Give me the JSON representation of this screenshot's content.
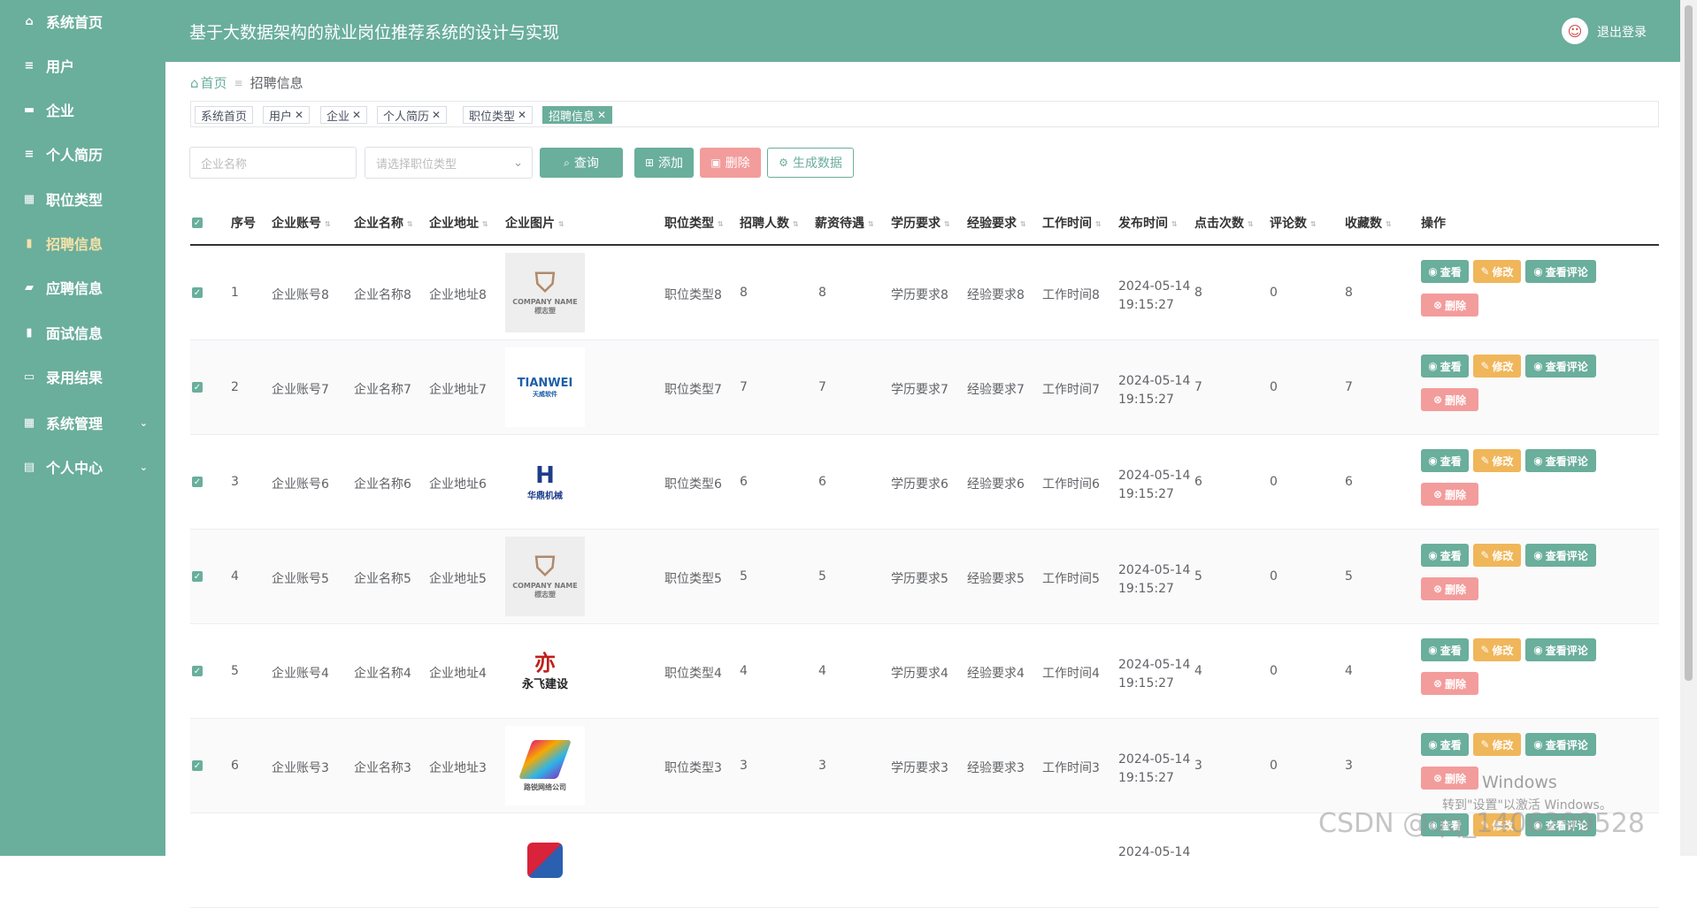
{
  "sidebar": {
    "items": [
      {
        "label": "系统首页",
        "icon": "home-icon"
      },
      {
        "label": "用户",
        "icon": "menu-icon"
      },
      {
        "label": "企业",
        "icon": "briefcase-icon"
      },
      {
        "label": "个人简历",
        "icon": "menu-icon"
      },
      {
        "label": "职位类型",
        "icon": "grid-icon"
      },
      {
        "label": "招聘信息",
        "icon": "clipboard-icon",
        "active": true
      },
      {
        "label": "应聘信息",
        "icon": "chat-icon"
      },
      {
        "label": "面试信息",
        "icon": "clipboard-icon"
      },
      {
        "label": "录用结果",
        "icon": "monitor-icon"
      },
      {
        "label": "系统管理",
        "icon": "grid-icon",
        "expandable": true
      },
      {
        "label": "个人中心",
        "icon": "calendar-icon",
        "expandable": true
      }
    ]
  },
  "header": {
    "title": "基于大数据架构的就业岗位推荐系统的设计与实现",
    "logout": "退出登录"
  },
  "breadcrumb": {
    "home": "首页",
    "current": "招聘信息"
  },
  "tags": [
    {
      "label": "系统首页",
      "closable": false
    },
    {
      "label": "用户",
      "closable": true
    },
    {
      "label": "企业",
      "closable": true
    },
    {
      "label": "个人简历",
      "closable": true
    },
    {
      "label": "职位类型",
      "closable": true
    },
    {
      "label": "招聘信息",
      "closable": true,
      "active": true
    }
  ],
  "filters": {
    "company_name_placeholder": "企业名称",
    "job_type_placeholder": "请选择职位类型",
    "search_label": "查询",
    "add_label": "添加",
    "delete_label": "删除",
    "generate_label": "生成数据"
  },
  "table": {
    "columns": [
      "序号",
      "企业账号",
      "企业名称",
      "企业地址",
      "企业图片",
      "职位类型",
      "招聘人数",
      "薪资待遇",
      "学历要求",
      "经验要求",
      "工作时间",
      "发布时间",
      "点击次数",
      "评论数",
      "收藏数",
      "操作"
    ],
    "rows": [
      {
        "index": "1",
        "account": "企业账号8",
        "name": "企业名称8",
        "address": "企业地址8",
        "logo": "company-name-logo",
        "type": "职位类型8",
        "recruits": "8",
        "salary": "8",
        "education": "学历要求8",
        "experience": "经验要求8",
        "worktime": "工作时间8",
        "date": "2024-05-14",
        "time": "19:15:27",
        "clicks": "8",
        "comments": "0",
        "favorites": "8"
      },
      {
        "index": "2",
        "account": "企业账号7",
        "name": "企业名称7",
        "address": "企业地址7",
        "logo": "tianwei-logo",
        "type": "职位类型7",
        "recruits": "7",
        "salary": "7",
        "education": "学历要求7",
        "experience": "经验要求7",
        "worktime": "工作时间7",
        "date": "2024-05-14",
        "time": "19:15:27",
        "clicks": "7",
        "comments": "0",
        "favorites": "7"
      },
      {
        "index": "3",
        "account": "企业账号6",
        "name": "企业名称6",
        "address": "企业地址6",
        "logo": "huading-logo",
        "type": "职位类型6",
        "recruits": "6",
        "salary": "6",
        "education": "学历要求6",
        "experience": "经验要求6",
        "worktime": "工作时间6",
        "date": "2024-05-14",
        "time": "19:15:27",
        "clicks": "6",
        "comments": "0",
        "favorites": "6"
      },
      {
        "index": "4",
        "account": "企业账号5",
        "name": "企业名称5",
        "address": "企业地址5",
        "logo": "company-name-logo",
        "type": "职位类型5",
        "recruits": "5",
        "salary": "5",
        "education": "学历要求5",
        "experience": "经验要求5",
        "worktime": "工作时间5",
        "date": "2024-05-14",
        "time": "19:15:27",
        "clicks": "5",
        "comments": "0",
        "favorites": "5"
      },
      {
        "index": "5",
        "account": "企业账号4",
        "name": "企业名称4",
        "address": "企业地址4",
        "logo": "yongfei-logo",
        "type": "职位类型4",
        "recruits": "4",
        "salary": "4",
        "education": "学历要求4",
        "experience": "经验要求4",
        "worktime": "工作时间4",
        "date": "2024-05-14",
        "time": "19:15:27",
        "clicks": "4",
        "comments": "0",
        "favorites": "4"
      },
      {
        "index": "6",
        "account": "企业账号3",
        "name": "企业名称3",
        "address": "企业地址3",
        "logo": "colorful-logo",
        "type": "职位类型3",
        "recruits": "3",
        "salary": "3",
        "education": "学历要求3",
        "experience": "经验要求3",
        "worktime": "工作时间3",
        "date": "2024-05-14",
        "time": "19:15:27",
        "clicks": "3",
        "comments": "0",
        "favorites": "3"
      },
      {
        "index": "",
        "account": "",
        "name": "",
        "address": "",
        "logo": "red-blue-logo",
        "type": "",
        "recruits": "",
        "salary": "",
        "education": "",
        "experience": "",
        "worktime": "",
        "date": "2024-05-14",
        "time": "",
        "clicks": "",
        "comments": "",
        "favorites": ""
      }
    ],
    "actions": {
      "view": "查看",
      "edit": "修改",
      "comments": "查看评论",
      "delete": "删除"
    }
  },
  "logo_text": {
    "company_name": "COMPANY NAME",
    "company_sub": "標志塑",
    "tianwei": "TIANWEI",
    "tianwei_sub": "天威软件",
    "huading": "华鼎机械",
    "yongfei": "永飞建设",
    "colorful": "路锐网络公司"
  },
  "overlay": {
    "windows_line1": "Windows",
    "windows_line2": "转到\"设置\"以激活 Windows。",
    "watermark": "CSDN @qq_1406299528"
  },
  "colors": {
    "primary": "#6aae9c",
    "view_btn": "#6aae9c",
    "edit_btn": "#f0b65a",
    "delete_btn": "#f39c9c",
    "active_menu": "#f5e2a8"
  }
}
